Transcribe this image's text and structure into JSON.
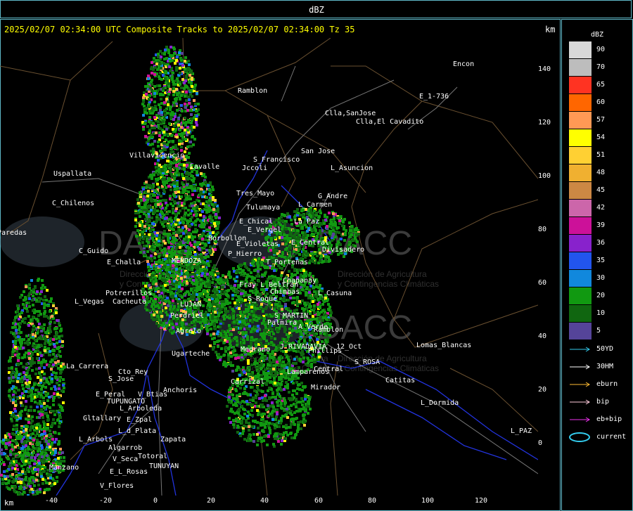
{
  "window": {
    "title": "dBZ"
  },
  "map": {
    "header": "2025/02/07 02:34:00 UTC Composite Tracks to 2025/02/07 02:34:00 Tz 35",
    "unit_top": "km",
    "unit_bottom": "km",
    "watermark_text": [
      "DACC",
      "Dirección de Agricultura",
      "y Contingencias Climáticas"
    ]
  },
  "y_ticks": [
    "140",
    "120",
    "100",
    "80",
    "60",
    "40",
    "20",
    "0"
  ],
  "x_ticks": [
    "-40",
    "-20",
    "0",
    "20",
    "40",
    "60",
    "80",
    "100",
    "120"
  ],
  "legend": {
    "title": "dBZ",
    "scale": [
      {
        "label": "90",
        "color": "#d8d8d8"
      },
      {
        "label": "70",
        "color": "#bdbdbd"
      },
      {
        "label": "65",
        "color": "#ff3322"
      },
      {
        "label": "60",
        "color": "#ff6600"
      },
      {
        "label": "57",
        "color": "#ff9955"
      },
      {
        "label": "54",
        "color": "#ffff00"
      },
      {
        "label": "51",
        "color": "#ffd033"
      },
      {
        "label": "48",
        "color": "#f0b030"
      },
      {
        "label": "45",
        "color": "#cc8844"
      },
      {
        "label": "42",
        "color": "#cc66aa"
      },
      {
        "label": "39",
        "color": "#cc1199"
      },
      {
        "label": "36",
        "color": "#8822cc"
      },
      {
        "label": "35",
        "color": "#2255ee"
      },
      {
        "label": "30",
        "color": "#1188dd"
      },
      {
        "label": "20",
        "color": "#119911"
      },
      {
        "label": "10",
        "color": "#106610"
      },
      {
        "label": "5",
        "color": "#554499"
      }
    ],
    "tracks": [
      {
        "label": "50YD",
        "color": "#33ccee"
      },
      {
        "label": "30HM",
        "color": "#ffffff"
      },
      {
        "label": "eburn",
        "color": "#ffbb33"
      },
      {
        "label": "bip",
        "color": "#ffccdd"
      },
      {
        "label": "eb+bip",
        "color": "#ee33ee"
      },
      {
        "label": "current",
        "color": "#33ccee"
      }
    ]
  },
  "places": [
    {
      "name": "Encon"
    },
    {
      "name": "Ramblon"
    },
    {
      "name": "E_1-736"
    },
    {
      "name": "Clla,SanJose"
    },
    {
      "name": "Clla,El Cavadito"
    },
    {
      "name": "San Jose"
    },
    {
      "name": "S_Francisco"
    },
    {
      "name": "Jccoli"
    },
    {
      "name": "L_Asuncion"
    },
    {
      "name": "Uspallata"
    },
    {
      "name": "Villavicencio"
    },
    {
      "name": "Lavalle"
    },
    {
      "name": "Tres_Mayo"
    },
    {
      "name": "G_Andre"
    },
    {
      "name": "C_Chilenos"
    },
    {
      "name": "Tulumaya"
    },
    {
      "name": "L_Carmen"
    },
    {
      "name": "E_Chical"
    },
    {
      "name": "La Paz"
    },
    {
      "name": "E_Vergel"
    },
    {
      "name": "Paredas"
    },
    {
      "name": "Borbollon"
    },
    {
      "name": "E_Central"
    },
    {
      "name": "C_Guido"
    },
    {
      "name": "E_Violetas"
    },
    {
      "name": "Divisadero"
    },
    {
      "name": "P_Hierro"
    },
    {
      "name": "E_Challa"
    },
    {
      "name": "MENDOZA"
    },
    {
      "name": "T_Porteñas"
    },
    {
      "name": "Chapanay"
    },
    {
      "name": "Potrerillos"
    },
    {
      "name": "Fray L_Beltran"
    },
    {
      "name": "Chimbas"
    },
    {
      "name": "L_Casuna"
    },
    {
      "name": "L_Vegas"
    },
    {
      "name": "Cacheuta"
    },
    {
      "name": "LUJAN"
    },
    {
      "name": "S_Roque"
    },
    {
      "name": "Perdriel"
    },
    {
      "name": "S_MARTIN"
    },
    {
      "name": "Agrelo"
    },
    {
      "name": "Palmira"
    },
    {
      "name": "A_Verde"
    },
    {
      "name": "J_RIVADAVIA"
    },
    {
      "name": "Ramblon"
    },
    {
      "name": "Ugarteche"
    },
    {
      "name": "12_Oct"
    },
    {
      "name": "Lomas_Blancas"
    },
    {
      "name": "La_Carrera"
    },
    {
      "name": "Medrano"
    },
    {
      "name": "Phillips"
    },
    {
      "name": "S_ROSA"
    },
    {
      "name": "Cto_Rey"
    },
    {
      "name": "Lamparenos"
    },
    {
      "name": "Central"
    },
    {
      "name": "S_Jose"
    },
    {
      "name": "Anchoris"
    },
    {
      "name": "Carrizal"
    },
    {
      "name": "Catitas"
    },
    {
      "name": "E_Peral"
    },
    {
      "name": "V_Btias"
    },
    {
      "name": "TUPUNGATO"
    },
    {
      "name": "Mirador"
    },
    {
      "name": "L_Dormida"
    },
    {
      "name": "L_Arboleda"
    },
    {
      "name": "Gltallary"
    },
    {
      "name": "E_Zpal"
    },
    {
      "name": "L_d_Plata"
    },
    {
      "name": "L_PAZ"
    },
    {
      "name": "L_Arbols"
    },
    {
      "name": "Zapata"
    },
    {
      "name": "Algarrob"
    },
    {
      "name": "V_Seca"
    },
    {
      "name": "Totoral"
    },
    {
      "name": "Manzano"
    },
    {
      "name": "E_L_Rosas"
    },
    {
      "name": "TUNUYAN"
    },
    {
      "name": "V_Flores"
    }
  ]
}
